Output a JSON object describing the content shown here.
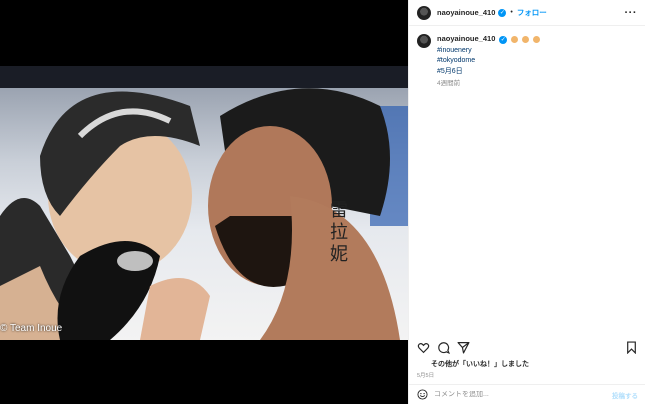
{
  "media": {
    "credit": "© Team Inoue"
  },
  "header": {
    "username": "naoyainoue_410",
    "separator": "•",
    "follow_label": "フォロー",
    "more_icon": "more-horizontal-icon"
  },
  "caption": {
    "username": "naoyainoue_410",
    "hashtags": [
      "#inouenery",
      "#tokyodome",
      "#5月6日"
    ],
    "time_ago": "4週間前"
  },
  "actions": {
    "like_icon": "heart-icon",
    "comment_icon": "comment-icon",
    "share_icon": "share-icon",
    "save_icon": "bookmark-icon"
  },
  "likes_text": "その他が「いいね！」しました",
  "date": "5月5日",
  "comment": {
    "placeholder": "コメントを追加...",
    "post_label": "投稿する"
  },
  "colors": {
    "accent": "#0095f6",
    "hashtag": "#00376b",
    "muted": "#8e8e8e"
  }
}
